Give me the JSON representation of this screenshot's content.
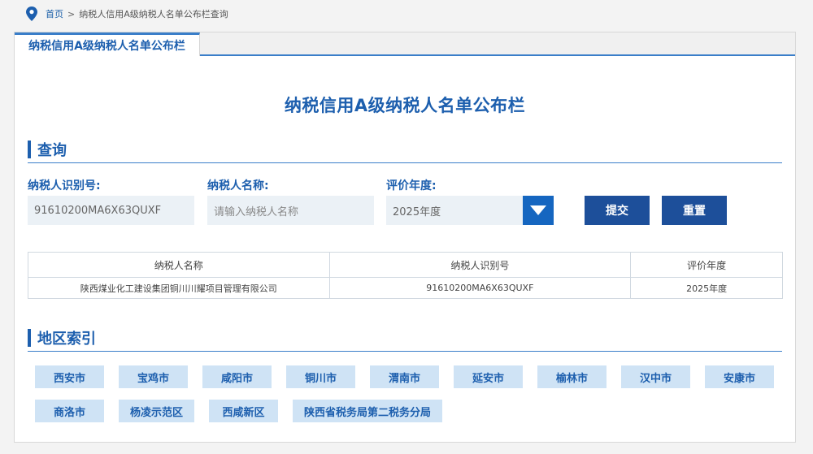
{
  "breadcrumb": {
    "home": "首页",
    "separator": ">",
    "current": "纳税人信用A级纳税人名单公布栏查询"
  },
  "tab": {
    "label": "纳税信用A级纳税人名单公布栏"
  },
  "main_title": "纳税信用A级纳税人名单公布栏",
  "query_section": {
    "title": "查询"
  },
  "form": {
    "taxpayer_id": {
      "label": "纳税人识别号:",
      "value": "91610200MA6X63QUXF"
    },
    "taxpayer_name": {
      "label": "纳税人名称:",
      "placeholder": "请输入纳税人名称",
      "value": ""
    },
    "year": {
      "label": "评价年度:",
      "selected": "2025年度"
    },
    "submit_label": "提交",
    "reset_label": "重置"
  },
  "results": {
    "headers": [
      "纳税人名称",
      "纳税人识别号",
      "评价年度"
    ],
    "rows": [
      [
        "陕西煤业化工建设集团铜川川耀项目管理有限公司",
        "91610200MA6X63QUXF",
        "2025年度"
      ]
    ]
  },
  "region_section": {
    "title": "地区索引"
  },
  "regions": [
    "西安市",
    "宝鸡市",
    "咸阳市",
    "铜川市",
    "渭南市",
    "延安市",
    "榆林市",
    "汉中市",
    "安康市",
    "商洛市",
    "杨凌示范区",
    "西咸新区",
    "陕西省税务局第二税务分局"
  ],
  "colors": {
    "primary": "#1d5fae",
    "button": "#1d4f9a",
    "region_bg": "#cfe3f5",
    "input_bg": "#ebf1f6"
  }
}
